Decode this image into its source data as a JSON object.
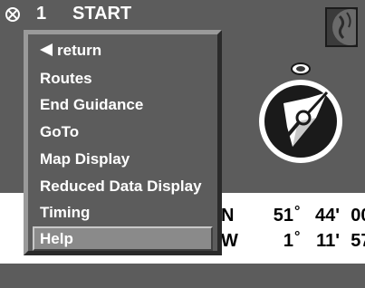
{
  "header": {
    "page_number": "1",
    "title": "START"
  },
  "menu": {
    "items": [
      {
        "label": "return",
        "icon": "triangle-left-icon",
        "selected": false
      },
      {
        "label": "Routes",
        "selected": false
      },
      {
        "label": "End Guidance",
        "selected": false
      },
      {
        "label": "GoTo",
        "selected": false
      },
      {
        "label": "Map Display",
        "selected": false
      },
      {
        "label": "Reduced Data Display",
        "selected": false
      },
      {
        "label": "Timing",
        "selected": false
      },
      {
        "label": "Help",
        "selected": true
      }
    ]
  },
  "coordinates": {
    "lat": {
      "dir": "N",
      "deg": "51",
      "min": "44'",
      "sec": "00\""
    },
    "lon": {
      "dir": "W",
      "deg": "1",
      "min": "11'",
      "sec": "57\""
    },
    "degree_symbol": "°"
  },
  "icons": {
    "close": "close-icon",
    "globe": "globe-icon",
    "compass": "compass-icon"
  },
  "colors": {
    "background": "#5c5c5c",
    "panel": "#ffffff",
    "highlight": "#8a8a8a"
  }
}
